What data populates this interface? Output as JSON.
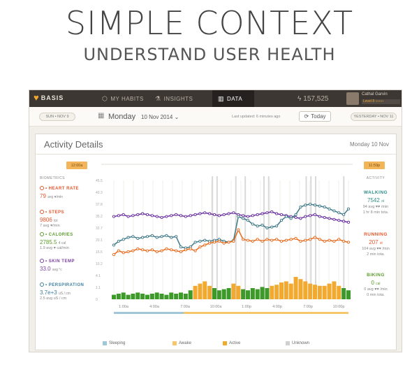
{
  "hero": {
    "title": "SIMPLE CONTEXT",
    "subtitle": "UNDERSTAND USER HEALTH"
  },
  "topbar": {
    "logo": "BASIS",
    "tabs": [
      {
        "label": "MY HABITS",
        "icon": "cube-icon"
      },
      {
        "label": "INSIGHTS",
        "icon": "flask-icon"
      },
      {
        "label": "DATA",
        "icon": "bar-chart-icon"
      }
    ],
    "points": "157,525",
    "user_name": "Cathal Garvin",
    "user_level": "Level 8"
  },
  "datebar": {
    "prev_button": "SUN • NOV 9",
    "day": "Monday",
    "date": "10 Nov 2014",
    "updated": "Last updated: 6 minutes ago",
    "today_button": "Today",
    "next_button": "YESTERDAY • NOV 11"
  },
  "panel": {
    "title": "Activity Details",
    "date": "Monday 10 Nov",
    "start_time": "12:00a",
    "end_time": "11:59p"
  },
  "biometrics": {
    "header": "BIOMETRICS",
    "items": [
      {
        "name": "HEART RATE",
        "value": "79",
        "unit": "avg ♥/min",
        "sub": "",
        "color": "#e8552a"
      },
      {
        "name": "STEPS",
        "value": "9806",
        "unit": "tot",
        "sub": "7 avg ♥/min",
        "color": "#e8552a"
      },
      {
        "name": "CALORIES",
        "value": "2785.5",
        "unit": "4 cal",
        "sub": "1.9 avg ♥ cal/min",
        "color": "#5a9b2a"
      },
      {
        "name": "SKIN TEMP",
        "value": "33.0",
        "unit": "avg °c",
        "sub": "",
        "color": "#7a3fa0"
      },
      {
        "name": "PERSPIRATION",
        "value": "3.7e+3",
        "unit": "uS / cm",
        "sub": "2.5 avg uS / cm",
        "color": "#3f7fa0"
      }
    ]
  },
  "activity": {
    "header": "ACTIVITY",
    "items": [
      {
        "name": "WALKING",
        "value": "7542",
        "unit": "st",
        "sub1": "94 avg ♥♥ /min",
        "sub2": "1 hr 8 min tota.",
        "color": "#2e8f88"
      },
      {
        "name": "RUNNING",
        "value": "207",
        "unit": "st",
        "sub1": "104 avg ♥♥ /min",
        "sub2": "2 min tota.",
        "color": "#e8552a"
      },
      {
        "name": "BIKING",
        "value": "0",
        "unit": "cal",
        "sub1": "0 avg ♥♥ /min",
        "sub2": "0 min tota.",
        "color": "#5a9b2a"
      }
    ]
  },
  "chart_data": {
    "type": "line",
    "x_labels": [
      "1:00a",
      "4:00a",
      "7:00a",
      "10:00a",
      "1:00p",
      "4:00p",
      "7:00p",
      "10:00p"
    ],
    "y_ticks": [
      "45.5",
      "40.3",
      "37.8",
      "35.2",
      "32.7",
      "20.1",
      "15.6",
      "10.2",
      "4.1",
      "1.1",
      "0"
    ],
    "ylim": [
      0,
      100
    ],
    "series": [
      {
        "color": "#6a2fa0",
        "values": [
          62,
          63,
          64,
          62,
          63,
          64,
          65,
          64,
          63,
          62,
          61,
          62,
          63,
          64,
          63,
          62,
          63,
          64,
          65,
          66,
          65,
          64,
          63,
          64,
          65,
          66,
          64,
          63,
          62,
          63,
          64,
          65,
          66,
          67,
          65,
          64,
          63,
          62,
          61,
          60,
          62,
          63,
          64,
          62,
          61,
          60,
          59,
          58,
          57,
          56
        ]
      },
      {
        "color": "#3f7a88",
        "values": [
          32,
          36,
          38,
          40,
          41,
          39,
          40,
          41,
          42,
          40,
          41,
          42,
          40,
          41,
          30,
          29,
          30,
          35,
          36,
          37,
          36,
          37,
          38,
          36,
          35,
          37,
          62,
          60,
          58,
          54,
          52,
          53,
          50,
          51,
          52,
          58,
          62,
          60,
          64,
          72,
          74,
          75,
          74,
          73,
          72,
          70,
          68,
          66,
          64,
          70
        ]
      },
      {
        "color": "#e86a1c",
        "values": [
          22,
          26,
          24,
          25,
          26,
          28,
          27,
          26,
          27,
          25,
          26,
          28,
          27,
          26,
          25,
          27,
          28,
          26,
          30,
          32,
          34,
          35,
          36,
          34,
          35,
          36,
          48,
          38,
          37,
          36,
          38,
          36,
          38,
          37,
          38,
          36,
          37,
          38,
          39,
          36,
          37,
          38,
          40,
          38,
          36,
          37,
          36,
          38,
          36,
          35
        ]
      }
    ],
    "bars": [
      4,
      5,
      6,
      4,
      5,
      6,
      5,
      4,
      5,
      6,
      5,
      4,
      6,
      5,
      6,
      5,
      8,
      12,
      14,
      16,
      12,
      10,
      8,
      9,
      10,
      14,
      12,
      9,
      8,
      10,
      9,
      11,
      10,
      12,
      13,
      15,
      16,
      14,
      20,
      18,
      16,
      14,
      13,
      12,
      12,
      14,
      16,
      12,
      10,
      8
    ],
    "legend": [
      "Sleeping",
      "Awake",
      "Active",
      "Unknown"
    ],
    "legend_colors": [
      "#9fc6d9",
      "#f5c76a",
      "#f2a930",
      "#d0d0d0"
    ]
  },
  "colors": {
    "accent": "#f0a830",
    "topbar": "#3d3733"
  }
}
